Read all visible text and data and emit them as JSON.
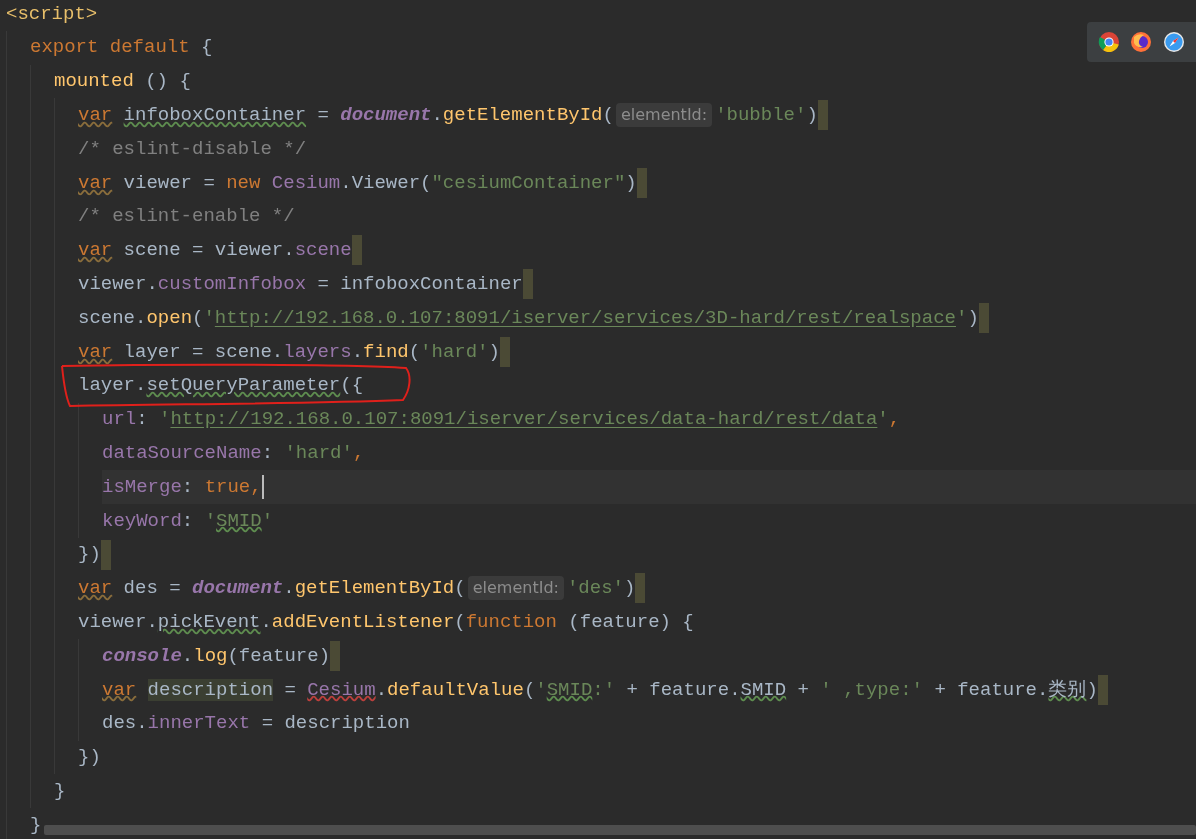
{
  "lines": [
    {
      "tokens": [
        {
          "text": "<script>",
          "kind": "tag"
        }
      ],
      "children": [
        {
          "tokens": [
            {
              "text": "export",
              "kind": "kw"
            },
            {
              "text": "default",
              "kind": "kw",
              "gap": true
            },
            {
              "text": "{",
              "kind": "plain",
              "gap": true
            }
          ],
          "children": [
            {
              "tokens": [
                {
                  "text": "mounted",
                  "kind": "func"
                },
                {
                  "text": "() {",
                  "kind": "plain",
                  "gap": true
                }
              ],
              "children": [
                {
                  "tokens": [
                    {
                      "text": "var",
                      "kind": "kw",
                      "warning": true
                    },
                    {
                      "text": "infoboxContainer",
                      "kind": "plain",
                      "typo": true,
                      "gap": true
                    },
                    {
                      "text": "=",
                      "kind": "plain",
                      "gap": true
                    },
                    {
                      "text": "document",
                      "kind": "global",
                      "gap": true
                    },
                    {
                      "text": ".",
                      "kind": "plain"
                    },
                    {
                      "text": "getElementById",
                      "kind": "func"
                    },
                    {
                      "text": "(",
                      "kind": "plain"
                    },
                    {
                      "text": "elementId:",
                      "kind": "hint"
                    },
                    {
                      "text": "'bubble'",
                      "kind": "str"
                    },
                    {
                      "text": ")",
                      "kind": "plain"
                    }
                  ],
                  "marker": true
                },
                {
                  "tokens": [
                    {
                      "text": "/* eslint-disable */",
                      "kind": "comment"
                    }
                  ]
                },
                {
                  "tokens": [
                    {
                      "text": "var",
                      "kind": "kw",
                      "warning": true
                    },
                    {
                      "text": "viewer =",
                      "kind": "plain",
                      "gap": true
                    },
                    {
                      "text": "new",
                      "kind": "kw",
                      "gap": true
                    },
                    {
                      "text": "Cesium",
                      "kind": "cls",
                      "gap": true
                    },
                    {
                      "text": ".Viewer(",
                      "kind": "plain"
                    },
                    {
                      "text": "\"cesiumContainer\"",
                      "kind": "str"
                    },
                    {
                      "text": ")",
                      "kind": "plain"
                    }
                  ],
                  "marker": true
                },
                {
                  "tokens": [
                    {
                      "text": "/* eslint-enable */",
                      "kind": "comment"
                    }
                  ]
                },
                {
                  "tokens": [
                    {
                      "text": "var",
                      "kind": "kw",
                      "warning": true
                    },
                    {
                      "text": "scene = viewer.",
                      "kind": "plain",
                      "gap": true
                    },
                    {
                      "text": "scene",
                      "kind": "prop"
                    }
                  ],
                  "marker": true
                },
                {
                  "tokens": [
                    {
                      "text": "viewer.",
                      "kind": "plain"
                    },
                    {
                      "text": "customInfobox",
                      "kind": "prop"
                    },
                    {
                      "text": " = infoboxContainer",
                      "kind": "plain"
                    }
                  ],
                  "marker": true
                },
                {
                  "tokens": [
                    {
                      "text": "scene.",
                      "kind": "plain"
                    },
                    {
                      "text": "open",
                      "kind": "func"
                    },
                    {
                      "text": "(",
                      "kind": "plain"
                    },
                    {
                      "text": "'",
                      "kind": "str"
                    },
                    {
                      "text": "http://192.168.0.107:8091/iserver/services/3D-hard/rest/realspace",
                      "kind": "url"
                    },
                    {
                      "text": "'",
                      "kind": "str"
                    },
                    {
                      "text": ")",
                      "kind": "plain"
                    }
                  ],
                  "marker": true
                },
                {
                  "tokens": [
                    {
                      "text": "var",
                      "kind": "kw",
                      "warning": true
                    },
                    {
                      "text": "layer = scene.",
                      "kind": "plain",
                      "gap": true
                    },
                    {
                      "text": "layers",
                      "kind": "prop"
                    },
                    {
                      "text": ".",
                      "kind": "plain"
                    },
                    {
                      "text": "find",
                      "kind": "func"
                    },
                    {
                      "text": "(",
                      "kind": "plain"
                    },
                    {
                      "text": "'hard'",
                      "kind": "str"
                    },
                    {
                      "text": ")",
                      "kind": "plain"
                    }
                  ],
                  "marker": true
                },
                {
                  "tokens": [
                    {
                      "text": "layer.",
                      "kind": "plain"
                    },
                    {
                      "text": "setQueryParameter",
                      "kind": "plain",
                      "typo": true
                    },
                    {
                      "text": "({",
                      "kind": "plain"
                    }
                  ],
                  "children": [
                    {
                      "tokens": [
                        {
                          "text": "url",
                          "kind": "prop"
                        },
                        {
                          "text": ": ",
                          "kind": "plain"
                        },
                        {
                          "text": "'",
                          "kind": "str"
                        },
                        {
                          "text": "http://192.168.0.107:8091/iserver/services/data-hard/rest/data",
                          "kind": "url"
                        },
                        {
                          "text": "'",
                          "kind": "str"
                        },
                        {
                          "text": ",",
                          "kind": "kw"
                        }
                      ]
                    },
                    {
                      "tokens": [
                        {
                          "text": "dataSourceName",
                          "kind": "prop"
                        },
                        {
                          "text": ": ",
                          "kind": "plain"
                        },
                        {
                          "text": "'hard'",
                          "kind": "str"
                        },
                        {
                          "text": ",",
                          "kind": "kw"
                        }
                      ]
                    },
                    {
                      "tokens": [
                        {
                          "text": "isMerge",
                          "kind": "prop"
                        },
                        {
                          "text": ": ",
                          "kind": "plain"
                        },
                        {
                          "text": "true,",
                          "kind": "kw"
                        }
                      ],
                      "current": true,
                      "caret": true
                    },
                    {
                      "tokens": [
                        {
                          "text": "keyWord",
                          "kind": "prop"
                        },
                        {
                          "text": ": ",
                          "kind": "plain"
                        },
                        {
                          "text": "'",
                          "kind": "str"
                        },
                        {
                          "text": "SMID",
                          "kind": "str",
                          "typo": true
                        },
                        {
                          "text": "'",
                          "kind": "str"
                        }
                      ]
                    }
                  ]
                },
                {
                  "tokens": [
                    {
                      "text": "})",
                      "kind": "plain"
                    }
                  ],
                  "marker": true
                },
                {
                  "tokens": [
                    {
                      "text": "var",
                      "kind": "kw",
                      "warning": true
                    },
                    {
                      "text": "des =",
                      "kind": "plain",
                      "gap": true
                    },
                    {
                      "text": "document",
                      "kind": "global",
                      "gap": true
                    },
                    {
                      "text": ".",
                      "kind": "plain"
                    },
                    {
                      "text": "getElementById",
                      "kind": "func"
                    },
                    {
                      "text": "(",
                      "kind": "plain"
                    },
                    {
                      "text": "elementId:",
                      "kind": "hint"
                    },
                    {
                      "text": "'des'",
                      "kind": "str"
                    },
                    {
                      "text": ")",
                      "kind": "plain"
                    }
                  ],
                  "marker": true
                },
                {
                  "tokens": [
                    {
                      "text": "viewer.",
                      "kind": "plain"
                    },
                    {
                      "text": "pickEvent",
                      "kind": "plain",
                      "typo": true
                    },
                    {
                      "text": ".",
                      "kind": "plain"
                    },
                    {
                      "text": "addEventListener",
                      "kind": "func"
                    },
                    {
                      "text": "(",
                      "kind": "plain"
                    },
                    {
                      "text": "function",
                      "kind": "kw"
                    },
                    {
                      "text": " (feature) {",
                      "kind": "plain"
                    }
                  ],
                  "children": [
                    {
                      "tokens": [
                        {
                          "text": "console",
                          "kind": "global"
                        },
                        {
                          "text": ".",
                          "kind": "plain"
                        },
                        {
                          "text": "log",
                          "kind": "func"
                        },
                        {
                          "text": "(feature)",
                          "kind": "plain"
                        }
                      ],
                      "marker": true
                    },
                    {
                      "tokens": [
                        {
                          "text": "var",
                          "kind": "kw",
                          "warning": true
                        },
                        {
                          "text": "description",
                          "kind": "plain",
                          "highlight": true,
                          "gap": true
                        },
                        {
                          "text": "=",
                          "kind": "plain",
                          "gap": true
                        },
                        {
                          "text": "Cesium",
                          "kind": "cls",
                          "error": true,
                          "gap": true
                        },
                        {
                          "text": ".",
                          "kind": "plain"
                        },
                        {
                          "text": "defaultValue",
                          "kind": "func"
                        },
                        {
                          "text": "(",
                          "kind": "plain"
                        },
                        {
                          "text": "'",
                          "kind": "str"
                        },
                        {
                          "text": "SMID",
                          "kind": "str",
                          "typo": true
                        },
                        {
                          "text": ":'",
                          "kind": "str"
                        },
                        {
                          "text": " + feature.",
                          "kind": "plain"
                        },
                        {
                          "text": "SMID",
                          "kind": "plain",
                          "typo": true
                        },
                        {
                          "text": " + ",
                          "kind": "plain"
                        },
                        {
                          "text": "' ,type:'",
                          "kind": "str"
                        },
                        {
                          "text": " + feature.",
                          "kind": "plain"
                        },
                        {
                          "text": "类别",
                          "kind": "plain",
                          "typo": true
                        },
                        {
                          "text": ")",
                          "kind": "plain"
                        }
                      ],
                      "marker": true
                    },
                    {
                      "tokens": [
                        {
                          "text": "des.",
                          "kind": "plain"
                        },
                        {
                          "text": "innerText",
                          "kind": "prop"
                        },
                        {
                          "text": " = description",
                          "kind": "plain"
                        }
                      ]
                    }
                  ]
                },
                {
                  "tokens": [
                    {
                      "text": "})",
                      "kind": "plain"
                    }
                  ]
                }
              ]
            },
            {
              "tokens": [
                {
                  "text": "}",
                  "kind": "plain"
                }
              ]
            }
          ]
        },
        {
          "tokens": [
            {
              "text": "}",
              "kind": "plain"
            }
          ]
        }
      ]
    }
  ]
}
